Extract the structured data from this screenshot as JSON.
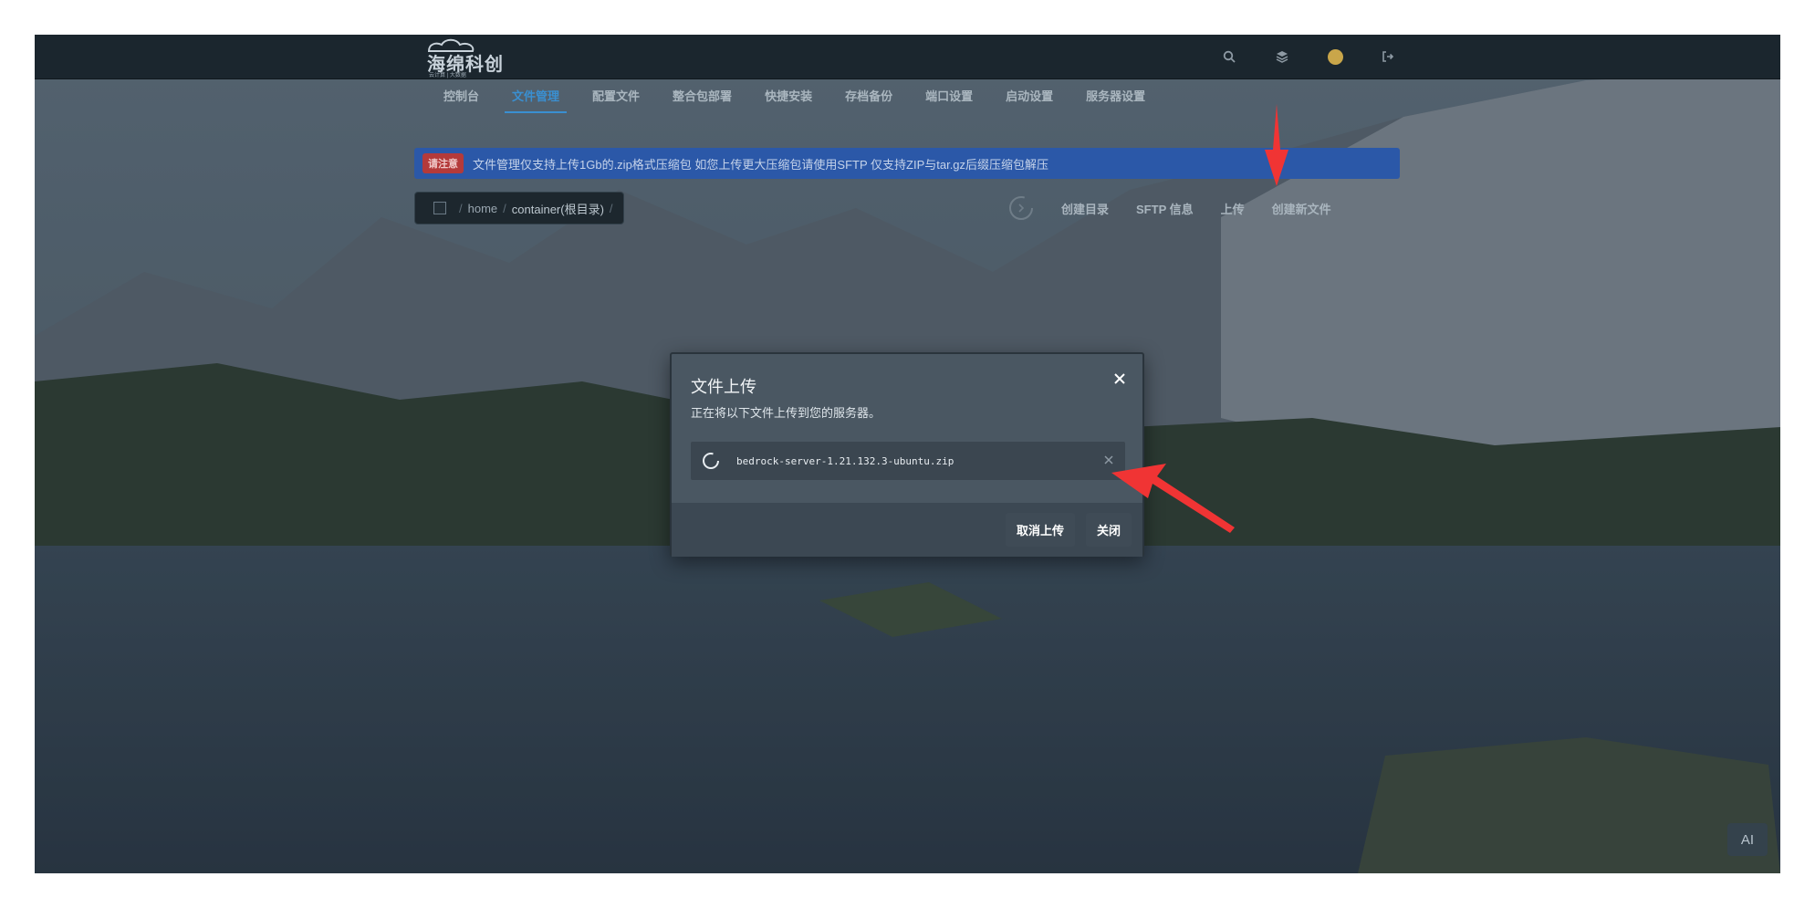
{
  "header": {
    "logo_text": "海绵科创",
    "logo_sub": "云计算 | 大数据",
    "icons": [
      "search-icon",
      "layers-icon",
      "avatar",
      "logout-icon"
    ]
  },
  "subnav": {
    "tabs": [
      {
        "label": "控制台"
      },
      {
        "label": "文件管理"
      },
      {
        "label": "配置文件"
      },
      {
        "label": "整合包部署"
      },
      {
        "label": "快捷安装"
      },
      {
        "label": "存档备份"
      },
      {
        "label": "端口设置"
      },
      {
        "label": "启动设置"
      },
      {
        "label": "服务器设置"
      }
    ],
    "active": "文件管理"
  },
  "notice": {
    "badge": "请注意",
    "text": "文件管理仅支持上传1Gb的.zip格式压缩包 如您上传更大压缩包请使用SFTP 仅支持ZIP与tar.gz后缀压缩包解压"
  },
  "breadcrumb": {
    "segments": [
      "home",
      "container(根目录)"
    ]
  },
  "actions": {
    "create_dir": "创建目录",
    "sftp": "SFTP 信息",
    "upload": "上传",
    "create_file": "创建新文件"
  },
  "modal": {
    "title": "文件上传",
    "subtitle": "正在将以下文件上传到您的服务器。",
    "file_name": "bedrock-server-1.21.132.3-ubuntu.zip",
    "cancel_label": "取消上传",
    "close_label": "关闭"
  },
  "ai_button": "AI",
  "colors": {
    "accent": "#3a8fd1",
    "notice_bg": "#2b58a8",
    "badge_bg": "#b43a3a",
    "arrow": "#f03434"
  }
}
